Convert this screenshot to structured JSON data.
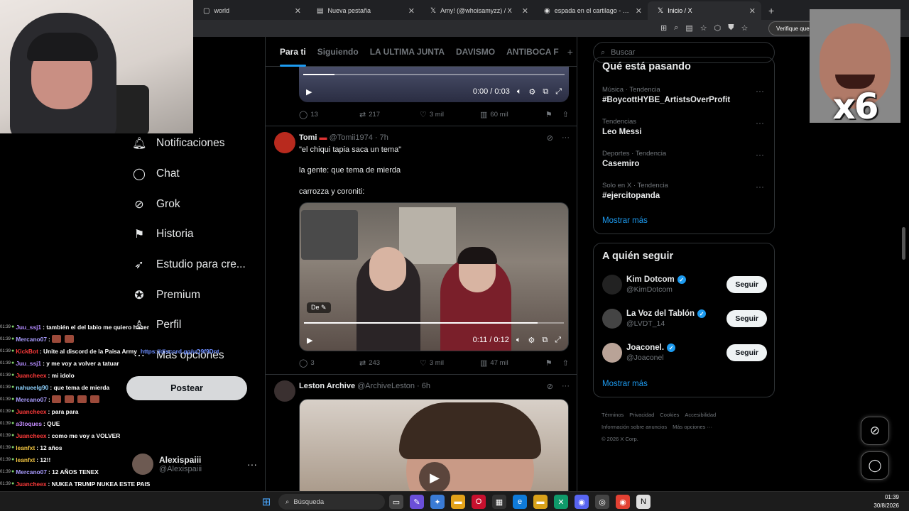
{
  "browser": {
    "tabs": [
      {
        "label": "world",
        "icon": "page-icon",
        "active": false
      },
      {
        "label": "Nueva pestaña",
        "icon": "newtab-icon",
        "active": false
      },
      {
        "label": "Amy! (@whoisamyzz) / X",
        "icon": "x-icon",
        "active": false
      },
      {
        "label": "espada en el cartilago - Buscar con",
        "icon": "google-icon",
        "active": false
      },
      {
        "label": "Inicio / X",
        "icon": "x-icon",
        "active": true
      }
    ],
    "new_tab": "+",
    "verify_label": "Verifique que e"
  },
  "overlay": {
    "meme_text": "x6"
  },
  "nav": {
    "items": [
      {
        "label": "Notificaciones",
        "icon": "bell-icon"
      },
      {
        "label": "Chat",
        "icon": "chat-icon"
      },
      {
        "label": "Grok",
        "icon": "grok-icon"
      },
      {
        "label": "Historia",
        "icon": "bookmark-icon"
      },
      {
        "label": "Estudio para cre...",
        "icon": "rocket-icon"
      },
      {
        "label": "Premium",
        "icon": "premium-icon"
      },
      {
        "label": "Perfil",
        "icon": "person-icon"
      },
      {
        "label": "Más opciones",
        "icon": "more-circle-icon"
      }
    ],
    "post_button": "Postear",
    "account": {
      "name": "Alexispaiii",
      "handle": "@Alexispaiii",
      "more": "···"
    }
  },
  "chat": [
    {
      "time": "01:39",
      "user": "Juu_ssj1",
      "color": "#b48cff",
      "text": ": también el del labio me quiero hacer",
      "emotes": 0
    },
    {
      "time": "01:39",
      "user": "Mercano07",
      "color": "#a99cff",
      "text": ":",
      "emotes": 2
    },
    {
      "time": "01:39",
      "user": "KickBot",
      "color": "#ff3b3b",
      "text": ": Unite al discord de la Paisa Army",
      "link": "https://discord.gg/uQ9f9Dnt",
      "emotes": 0
    },
    {
      "time": "01:39",
      "user": "Juu_ssj1",
      "color": "#b48cff",
      "text": ": y me voy a volver a tatuar",
      "emotes": 0
    },
    {
      "time": "01:39",
      "user": "Juancheex",
      "color": "#ff3b3b",
      "text": ": mi idolo",
      "emotes": 0
    },
    {
      "time": "01:39",
      "user": "nahueelg90",
      "color": "#8fd3ff",
      "text": ": que tema de mierda",
      "emotes": 0
    },
    {
      "time": "01:39",
      "user": "Mercano07",
      "color": "#a99cff",
      "text": ":",
      "emotes": 4
    },
    {
      "time": "01:39",
      "user": "Juancheex",
      "color": "#ff3b3b",
      "text": ": para para",
      "emotes": 0
    },
    {
      "time": "01:39",
      "user": "a3toques",
      "color": "#c58cff",
      "text": ": QUE",
      "emotes": 0
    },
    {
      "time": "01:39",
      "user": "Juancheex",
      "color": "#ff3b3b",
      "text": ": como me voy a VOLVER",
      "emotes": 0
    },
    {
      "time": "01:39",
      "user": "leanfxt",
      "color": "#f5c842",
      "text": ": 12 años",
      "emotes": 0
    },
    {
      "time": "01:39",
      "user": "leanfxt",
      "color": "#f5c842",
      "text": ": 12!!",
      "emotes": 0
    },
    {
      "time": "01:39",
      "user": "Mercano07",
      "color": "#a99cff",
      "text": ": 12 AÑOS TENEX",
      "emotes": 0
    },
    {
      "time": "01:39",
      "user": "Juancheex",
      "color": "#ff3b3b",
      "text": ": NUKEA TRUMP NUKEA ESTE PAIS",
      "emotes": 0
    },
    {
      "time": "01:39",
      "user": "Mercano07",
      "color": "#a99cff",
      "text": ": COMO QUE VOLVER A TATUAR",
      "emotes": 0
    }
  ],
  "timeline": {
    "tabs": [
      "Para ti",
      "Siguiendo",
      "LA ULTIMA JUNTA",
      "DAVISMO",
      "ANTIBOCA F"
    ],
    "active_tab": 0,
    "plus": "+",
    "top_video": {
      "time": "0:00 / 0:03",
      "progress": 0.12
    },
    "top_actions": {
      "replies": "13",
      "reposts": "217",
      "likes": "3 mil",
      "views": "60 mil"
    },
    "posts": [
      {
        "name": "Tomi",
        "handle": "@Tomii1974 · 7h",
        "lines": [
          "\"el chiqui tapia saca un tema\"",
          "la gente: que tema de mierda",
          "carrozza y coroniti:"
        ],
        "video": {
          "time": "0:11 / 0:12",
          "progress": 0.9,
          "badge": "De"
        },
        "actions": {
          "replies": "3",
          "reposts": "243",
          "likes": "3 mil",
          "views": "47 mil"
        }
      },
      {
        "name": "Leston Archive",
        "handle": "@ArchiveLeston · 6h"
      }
    ]
  },
  "right": {
    "search_placeholder": "Buscar",
    "trends_title": "Qué está pasando",
    "trends": [
      {
        "category": "Música · Tendencia",
        "name": "#BoycottHYBE_ArtistsOverProfit"
      },
      {
        "category": "Tendencias",
        "name": "Leo Messi"
      },
      {
        "category": "Deportes · Tendencia",
        "name": "Casemiro"
      },
      {
        "category": "Solo en X · Tendencia",
        "name": "#ejercitopanda"
      }
    ],
    "trends_more": "Mostrar más",
    "follow_title": "A quién seguir",
    "follow": [
      {
        "name": "Kim Dotcom",
        "handle": "@KimDotcom",
        "button": "Seguir"
      },
      {
        "name": "La Voz del Tablón",
        "handle": "@LVDT_14",
        "button": "Seguir"
      },
      {
        "name": "Joaconel.",
        "handle": "@Joaconel",
        "button": "Seguir"
      }
    ],
    "follow_more": "Mostrar más",
    "footer": [
      "Términos",
      "Privacidad",
      "Cookies",
      "Accesibilidad",
      "Información sobre anuncios",
      "Más opciones ···",
      "© 2026 X Corp."
    ]
  },
  "taskbar": {
    "search": "Búsqueda",
    "time": "01:39",
    "date": "30/8/2026"
  }
}
